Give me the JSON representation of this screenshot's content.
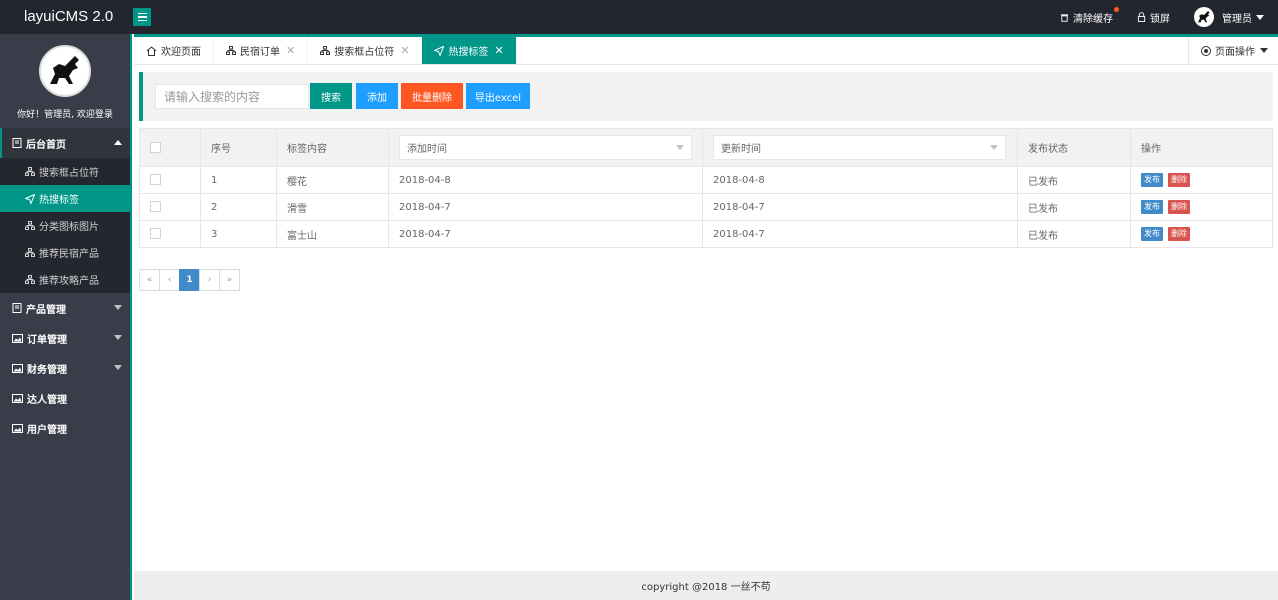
{
  "header": {
    "logo": "layuiCMS 2.0",
    "clear_cache": "清除缓存",
    "lock_screen": "锁屏",
    "user_name": "管理员"
  },
  "sidebar": {
    "greeting": "你好！管理员, 欢迎登录",
    "groups": [
      {
        "label": "后台首页",
        "icon": "home-doc-icon"
      },
      {
        "label": "产品管理",
        "icon": "doc-icon"
      },
      {
        "label": "订单管理",
        "icon": "image-icon"
      },
      {
        "label": "财务管理",
        "icon": "image-icon"
      },
      {
        "label": "达人管理",
        "icon": "image-icon"
      },
      {
        "label": "用户管理",
        "icon": "image-icon"
      }
    ],
    "sub_items": [
      {
        "label": "搜索框占位符",
        "icon": "sitemap-icon"
      },
      {
        "label": "热搜标签",
        "icon": "send-icon",
        "active": true
      },
      {
        "label": "分类图标图片",
        "icon": "sitemap-icon"
      },
      {
        "label": "推荐民宿产品",
        "icon": "sitemap-icon"
      },
      {
        "label": "推荐攻略产品",
        "icon": "sitemap-icon"
      }
    ]
  },
  "tabs": [
    {
      "label": "欢迎页面",
      "icon": "home-icon",
      "closable": false
    },
    {
      "label": "民宿订单",
      "icon": "sitemap-icon",
      "closable": true
    },
    {
      "label": "搜索框占位符",
      "icon": "sitemap-icon",
      "closable": true
    },
    {
      "label": "热搜标签",
      "icon": "send-icon",
      "closable": true,
      "active": true
    }
  ],
  "page_ops": "页面操作",
  "toolbar": {
    "search_placeholder": "请输入搜索的内容",
    "search_btn": "搜索",
    "add_btn": "添加",
    "batch_delete_btn": "批量删除",
    "export_btn": "导出excel",
    "colors": {
      "search": "#009688",
      "add": "#1e9fff",
      "batch_delete": "#ff5722",
      "export": "#1e9fff"
    }
  },
  "table": {
    "headers": {
      "index": "序号",
      "content": "标签内容",
      "added": "添加时间",
      "updated": "更新时间",
      "status": "发布状态",
      "actions": "操作"
    },
    "rows": [
      {
        "index": "1",
        "content": "樱花",
        "added": "2018-04-8",
        "updated": "2018-04-8",
        "status": "已发布"
      },
      {
        "index": "2",
        "content": "滑雪",
        "added": "2018-04-7",
        "updated": "2018-04-7",
        "status": "已发布"
      },
      {
        "index": "3",
        "content": "富士山",
        "added": "2018-04-7",
        "updated": "2018-04-7",
        "status": "已发布"
      }
    ],
    "publish_label": "发布",
    "delete_label": "删除"
  },
  "pagination": {
    "first": "«",
    "prev": "‹",
    "current": "1",
    "next": "›",
    "last": "»"
  },
  "footer": "copyright @2018 一丝不苟"
}
